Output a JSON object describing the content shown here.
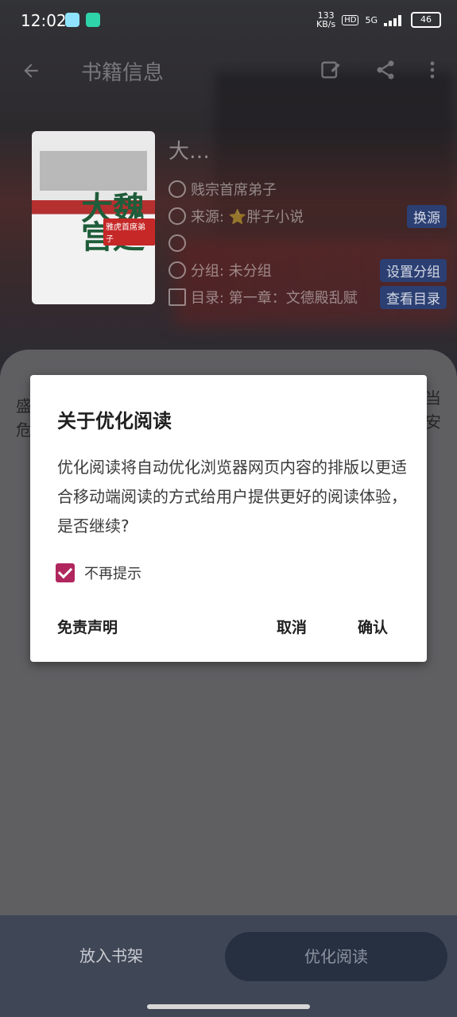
{
  "status": {
    "time": "12:02",
    "speed": "133\nKB/s",
    "hd": "HD",
    "network": "5G",
    "battery": "46"
  },
  "appbar": {
    "title": "书籍信息"
  },
  "book": {
    "title": "大…",
    "author": "贱宗首席弟子",
    "source_label": "来源: ⭐胖子小说",
    "group_label": "分组: 未分组",
    "toc_label": "目录: 第一章：文德殿乱赋",
    "btn_change_source": "换源",
    "btn_set_group": "设置分组",
    "btn_view_toc": "查看目录",
    "cover_title": "大魏宫廷",
    "cover_badge": "雅虎首席弟子"
  },
  "sheet": {
    "bg_left": "盛\n危",
    "bg_right": "当\n安"
  },
  "dialog": {
    "title": "关于优化阅读",
    "body": "优化阅读将自动优化浏览器网页内容的排版以更适合移动端阅读的方式给用户提供更好的阅读体验，是否继续?",
    "checkbox_label": "不再提示",
    "disclaimer": "免责声明",
    "cancel": "取消",
    "confirm": "确认"
  },
  "bottom": {
    "add_shelf": "放入书架",
    "optimize": "优化阅读"
  }
}
